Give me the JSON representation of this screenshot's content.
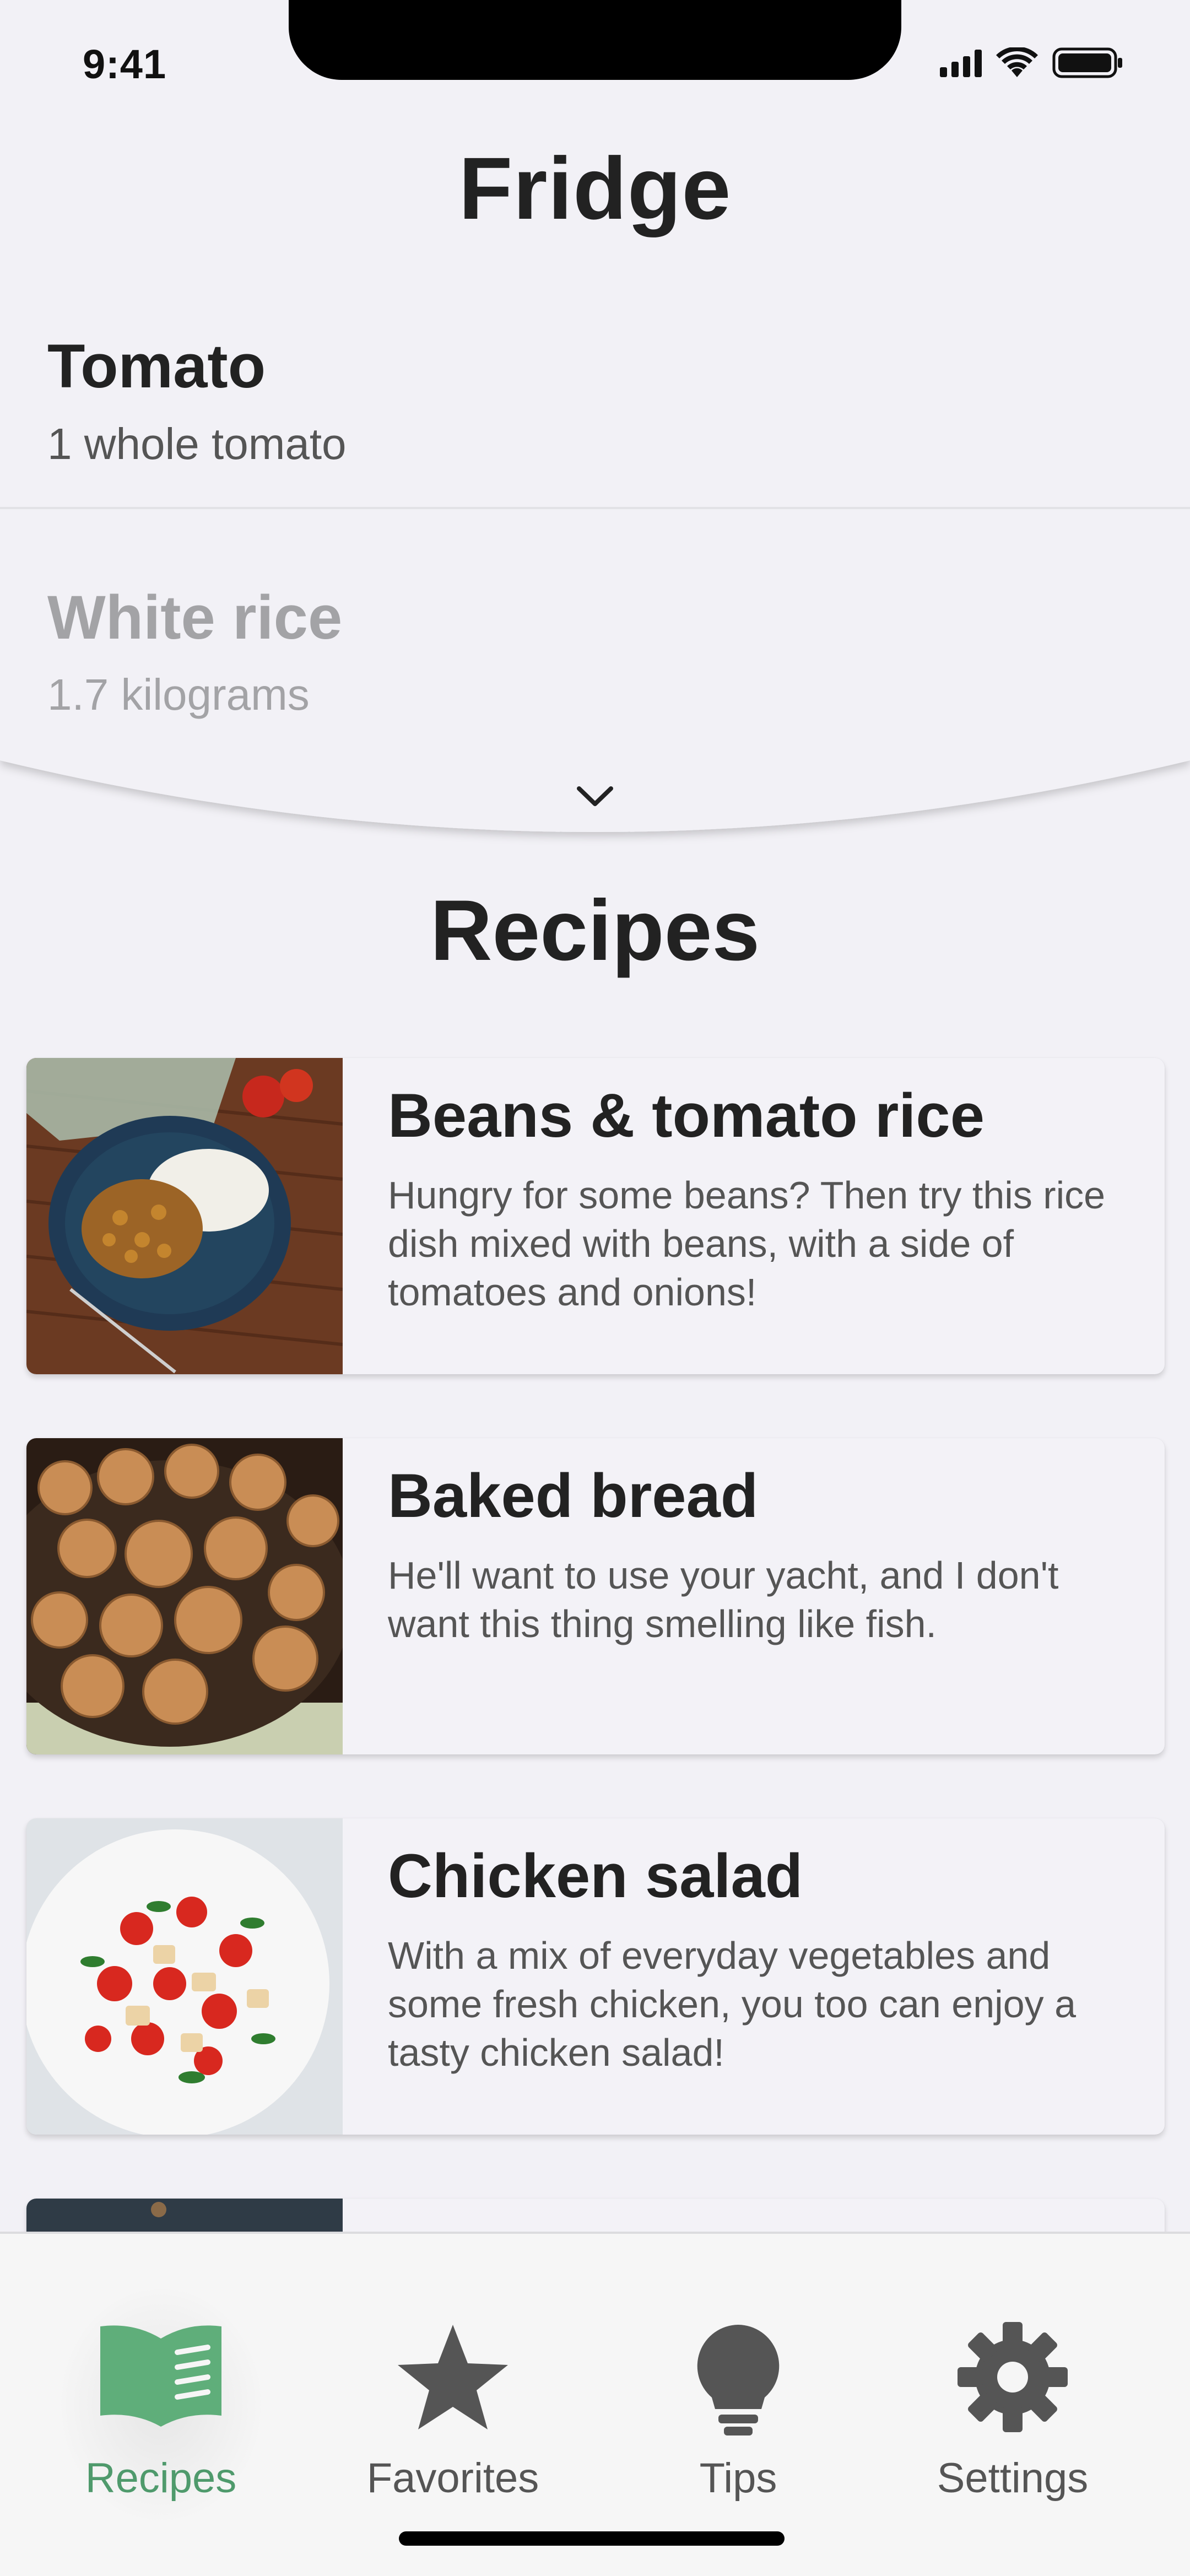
{
  "status_bar": {
    "time": "9:41",
    "icons": [
      "cellular-signal-icon",
      "wifi-icon",
      "battery-icon"
    ]
  },
  "fridge": {
    "title": "Fridge",
    "items": [
      {
        "name": "Tomato",
        "amount": "1 whole tomato"
      },
      {
        "name": "White rice",
        "amount": "1.7 kilograms"
      }
    ],
    "expand_icon": "chevron-down-icon"
  },
  "recipes": {
    "title": "Recipes",
    "items": [
      {
        "title": "Beans & tomato rice",
        "description": "Hungry for some beans? Then try this rice dish mixed with beans, with a side of tomatoes and onions!"
      },
      {
        "title": "Baked bread",
        "description": "He'll want to use your yacht, and I don't want this thing smelling like fish."
      },
      {
        "title": "Chicken salad",
        "description": "With a mix of everyday vegetables and some fresh chicken, you too can enjoy a tasty chicken salad!"
      }
    ]
  },
  "tab_bar": {
    "active_color": "#4f9a6c",
    "inactive_color": "#555555",
    "tabs": [
      {
        "label": "Recipes",
        "icon": "open-book-icon",
        "active": true
      },
      {
        "label": "Favorites",
        "icon": "star-icon",
        "active": false
      },
      {
        "label": "Tips",
        "icon": "lightbulb-icon",
        "active": false
      },
      {
        "label": "Settings",
        "icon": "gear-icon",
        "active": false
      }
    ]
  }
}
